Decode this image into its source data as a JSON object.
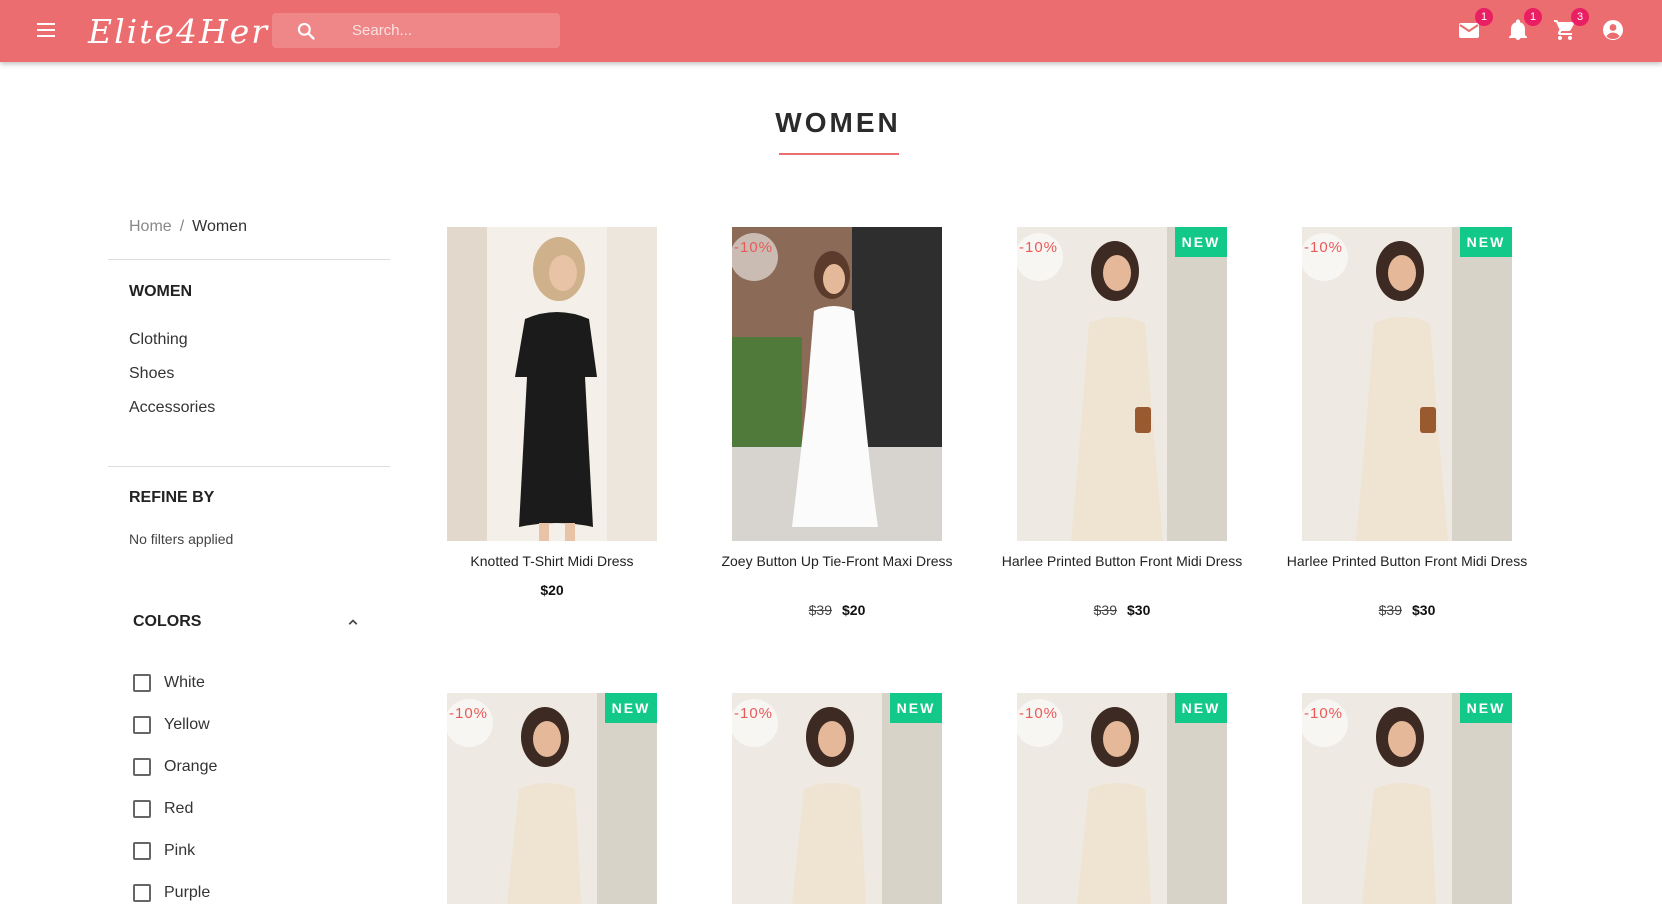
{
  "header": {
    "logo": "Elite4Her",
    "search_placeholder": "Search...",
    "mail_count": "1",
    "notifications_count": "1",
    "cart_count": "3"
  },
  "page_title": "WOMEN",
  "breadcrumb": {
    "home": "Home",
    "separator": "/",
    "current": "Women"
  },
  "sidebar": {
    "category_heading": "WOMEN",
    "categories": [
      "Clothing",
      "Shoes",
      "Accessories"
    ],
    "refine_heading": "REFINE BY",
    "no_filters": "No filters applied",
    "colors_heading": "COLORS",
    "colors": [
      "White",
      "Yellow",
      "Orange",
      "Red",
      "Pink",
      "Purple"
    ]
  },
  "products": [
    {
      "name": "Knotted T-Shirt Midi Dress",
      "old_price": "",
      "price": "$20",
      "discount": "",
      "badge": ""
    },
    {
      "name": "Zoey Button Up Tie-Front Maxi Dress",
      "old_price": "$39",
      "price": "$20",
      "discount": "-10%",
      "badge": ""
    },
    {
      "name": "Harlee Printed Button Front Midi Dress",
      "old_price": "$39",
      "price": "$30",
      "discount": "-10%",
      "badge": "NEW"
    },
    {
      "name": "Harlee Printed Button Front Midi Dress",
      "old_price": "$39",
      "price": "$30",
      "discount": "-10%",
      "badge": "NEW"
    },
    {
      "name": "",
      "old_price": "",
      "price": "",
      "discount": "-10%",
      "badge": "NEW"
    },
    {
      "name": "",
      "old_price": "",
      "price": "",
      "discount": "-10%",
      "badge": "NEW"
    },
    {
      "name": "",
      "old_price": "",
      "price": "",
      "discount": "-10%",
      "badge": "NEW"
    },
    {
      "name": "",
      "old_price": "",
      "price": "",
      "discount": "-10%",
      "badge": "NEW"
    }
  ],
  "colors": {
    "header_bg": "#ec6d6f",
    "accent": "#ec6d6f",
    "new_badge": "#12c98a",
    "count_badge": "#e91e63"
  }
}
